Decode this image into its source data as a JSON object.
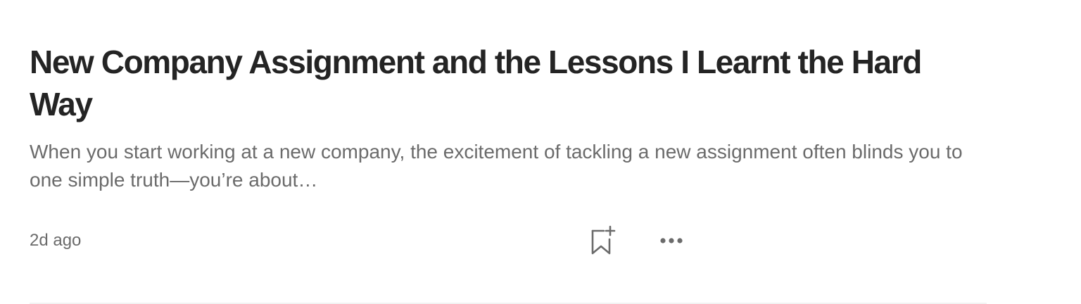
{
  "article": {
    "title": "New Company Assignment and the Lessons I Learnt the Hard Way",
    "subtitle": "When you start working at a new company, the excitement of tackling a new assignment often blinds you to one simple truth—you’re about…",
    "published": "2d ago"
  },
  "actions": {
    "save_icon": "bookmark-add-icon",
    "more_icon": "more-horizontal-icon"
  },
  "colors": {
    "title": "#242424",
    "muted": "#6b6b6b",
    "divider": "#f2f2f2"
  }
}
